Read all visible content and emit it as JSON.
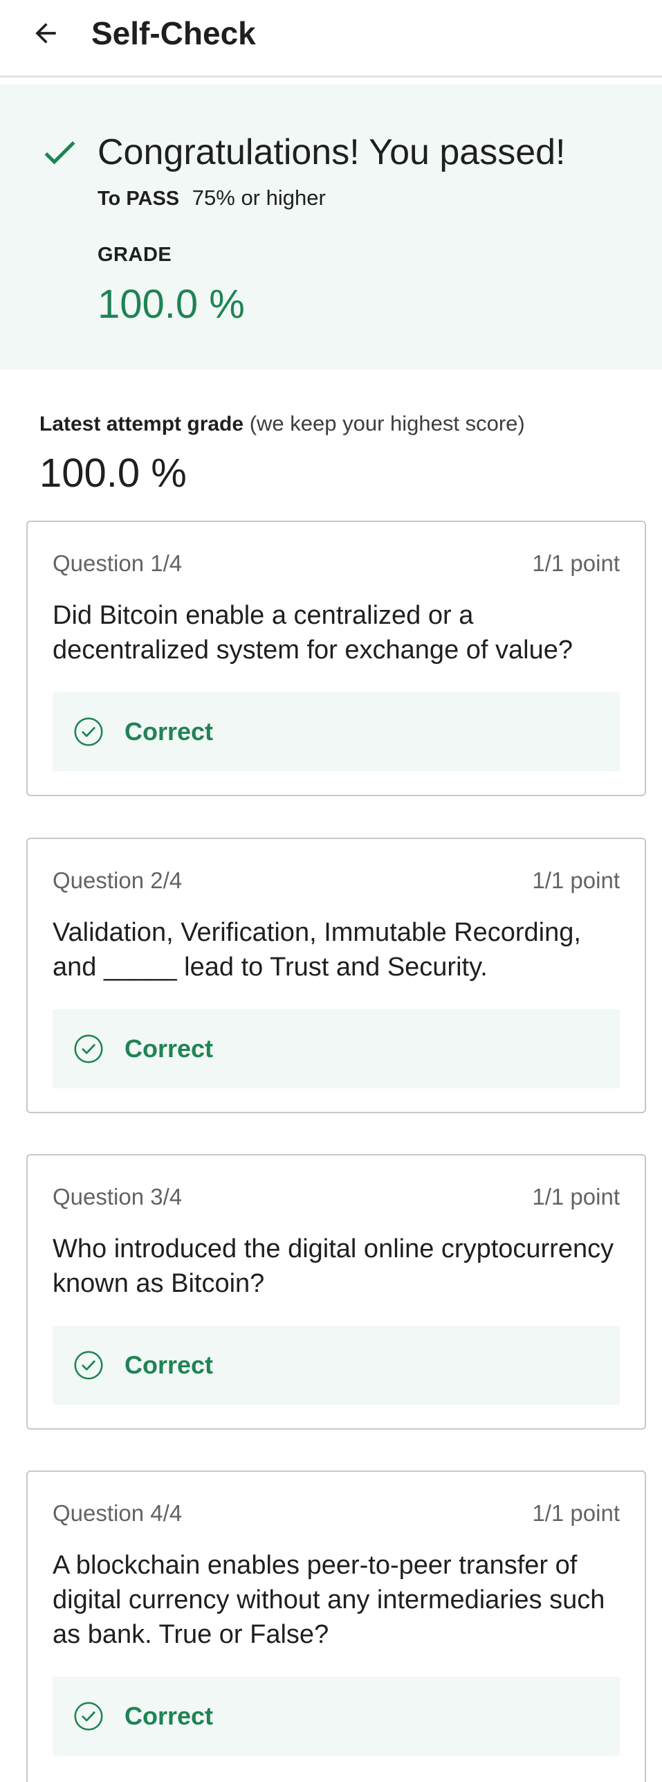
{
  "header": {
    "title": "Self-Check"
  },
  "result": {
    "title": "Congratulations! You passed!",
    "pass_label": "To PASS",
    "pass_requirement": "75% or higher",
    "grade_label": "GRADE",
    "grade_value": "100.0 %"
  },
  "latest": {
    "label": "Latest attempt grade",
    "note": "(we keep your highest score)",
    "value": "100.0 %"
  },
  "questions": [
    {
      "number": "Question 1/4",
      "points": "1/1 point",
      "text": "Did Bitcoin enable a centralized or a decentralized system for exchange of value?",
      "result": "Correct"
    },
    {
      "number": "Question 2/4",
      "points": "1/1 point",
      "text": "Validation, Verification, Immutable Recording, and _____ lead to Trust and Security.",
      "result": "Correct"
    },
    {
      "number": "Question 3/4",
      "points": "1/1 point",
      "text": "Who introduced the digital online cryptocurrency known as Bitcoin?",
      "result": "Correct"
    },
    {
      "number": "Question 4/4",
      "points": "1/1 point",
      "text": "A blockchain enables peer-to-peer transfer of digital currency without any intermediaries such as bank. True or False?",
      "result": "Correct"
    }
  ],
  "icons": {
    "back": "arrow-left-icon",
    "passed": "checkmark-icon",
    "correct": "check-circle-icon"
  },
  "colors": {
    "success": "#1f8354",
    "success_background": "#f1f8f5",
    "card_border": "#c8c8c8",
    "muted_text": "#636363"
  }
}
